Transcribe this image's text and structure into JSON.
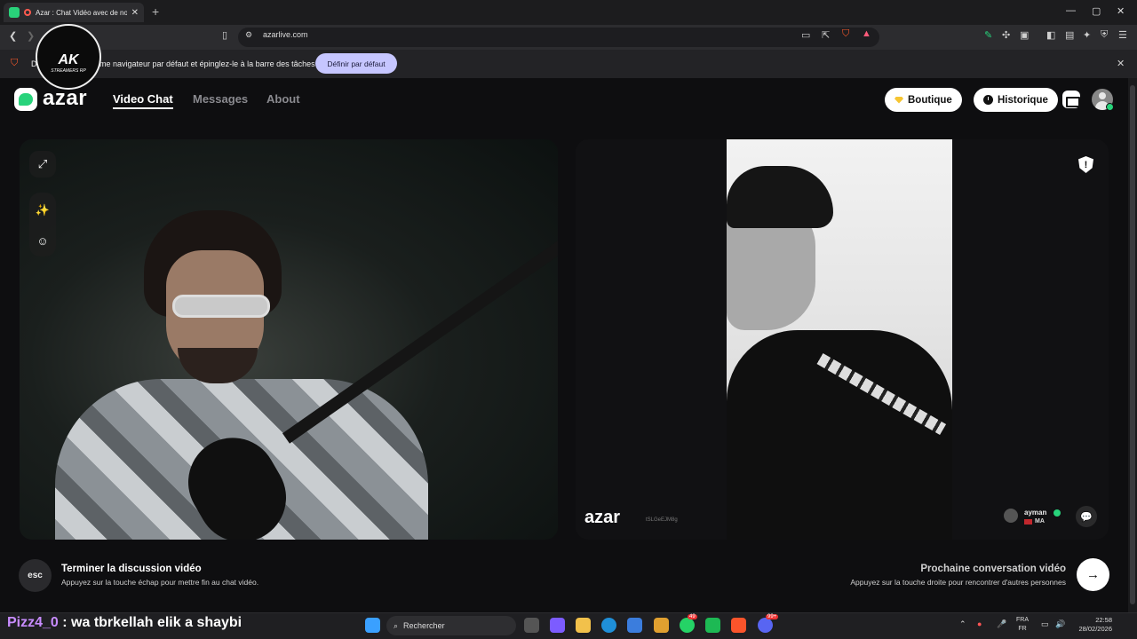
{
  "browser": {
    "tab_title": "Azar : Chat Vidéo avec de no",
    "tab_close": "✕",
    "new_tab": "+",
    "url": "azarlive.com",
    "info_bar_text": "me navigateur par défaut et épinglez-le à la barre des tâches",
    "info_bar_prefix": "D",
    "info_bar_button": "Définir par défaut",
    "info_bar_close": "✕",
    "window_minimize": "—",
    "window_maximize": "▢",
    "window_close": "✕"
  },
  "overlay_logo": {
    "title": "AK",
    "subtitle": "STREAMERS RP"
  },
  "header": {
    "logo_text": "azar",
    "nav": [
      {
        "label": "Video Chat",
        "active": true
      },
      {
        "label": "Messages",
        "active": false
      },
      {
        "label": "About",
        "active": false
      }
    ],
    "shop_label": "Boutique",
    "history_label": "Historique"
  },
  "remote": {
    "watermark": "azar",
    "watermark_id": "tSLGeEJM8g",
    "peer_name": "ayman",
    "peer_country": "MA"
  },
  "controls": {
    "esc_key": "esc",
    "end_title": "Terminer la discussion vidéo",
    "end_subtitle": "Appuyez sur la touche échap pour mettre fin au chat vidéo.",
    "next_title": "Prochaine conversation vidéo",
    "next_subtitle": "Appuyez sur la touche droite pour rencontrer d'autres personnes",
    "next_symbol": "→"
  },
  "stream_overlay": {
    "user": "Pizz4_0",
    "message": ": wa tbrkellah elik a shaybi"
  },
  "taskbar": {
    "search_placeholder": "Rechercher",
    "lang_line1": "FRA",
    "lang_line2": "FR",
    "time": "22:58",
    "date": "28/02/2026",
    "whatsapp_badge": "49",
    "discord_badge": "99+"
  },
  "colors": {
    "accent_green": "#28d37b",
    "info_button": "#c6c6ff",
    "overlay_user": "#c88cff"
  }
}
